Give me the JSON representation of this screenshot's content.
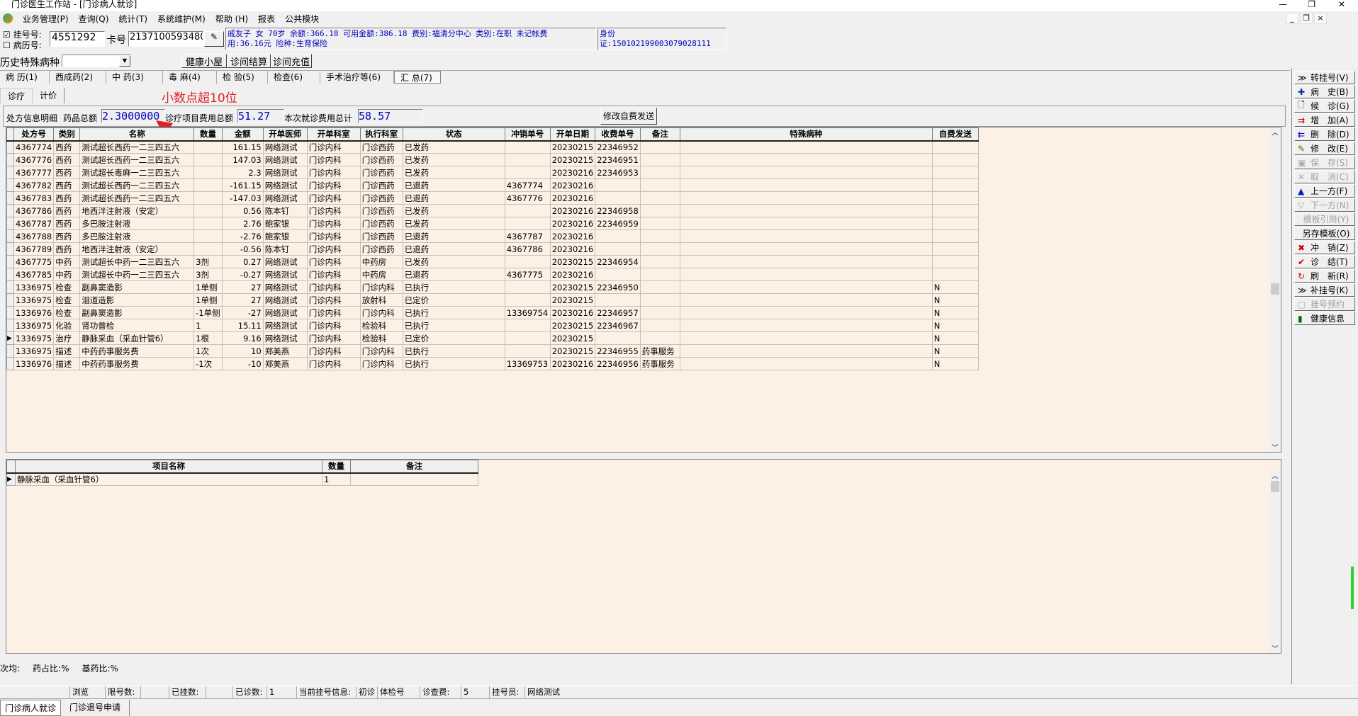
{
  "window": {
    "title": "门诊医生工作站 - [门诊病人就诊]"
  },
  "menu": [
    "业务管理(P)",
    "查询(Q)",
    "统计(T)",
    "系统维护(M)",
    "帮助 (H)",
    "报表",
    "公共模块"
  ],
  "patient": {
    "reg_checkbox_label": "挂号号:",
    "reg_checked": true,
    "record_checkbox_label": "病历号:",
    "record_checked": false,
    "reg_no": "4551292",
    "card_label": "卡号",
    "card_no": "2137100593480",
    "info_line1": "戚友子  女  70岁  余额:366.18  可用金额:386.18  费别:福清分中心  类别:在职  未记帐费",
    "info_line2": "用:36.16元  险种:生育保险",
    "id_line1": "身份",
    "id_line2": "证:150102199003079028111"
  },
  "history": {
    "label": "历史特殊病种",
    "value": "",
    "buttons": [
      "健康小屋",
      "诊间结算",
      "诊间充值"
    ]
  },
  "tabs": [
    "病 历(1)",
    "西成药(2)",
    "中 药(3)",
    "毒 麻(4)",
    "检 验(5)",
    "检查(6)",
    "手术治疗等(6)",
    "汇 总(7)"
  ],
  "active_tab": 7,
  "subtabs": [
    "诊疗",
    "计价"
  ],
  "annotation": {
    "text": "小数点超10位",
    "color": "#e02020"
  },
  "summary": {
    "label": "处方信息明细",
    "drug_label": "药品总额",
    "drug_total": "2.3000000",
    "item_label": "诊疗项目费用总额",
    "item_total": "51.27",
    "visit_label": "本次就诊费用总计",
    "visit_total": "58.57",
    "modify_button": "修改自费发送"
  },
  "main_table": {
    "columns": [
      "处方号",
      "类别",
      "名称",
      "数量",
      "金额",
      "开单医师",
      "开单科室",
      "执行科室",
      "状态",
      "冲销单号",
      "开单日期",
      "收费单号",
      "备注",
      "特殊病种",
      "自费发送"
    ],
    "current_row": 15,
    "rows": [
      [
        "4367774",
        "西药",
        "测试超长西药一二三四五六",
        "",
        "161.15",
        "网络测试",
        "门诊内科",
        "门诊西药",
        "已发药",
        "",
        "20230215",
        "22346952",
        "",
        "",
        ""
      ],
      [
        "4367776",
        "西药",
        "测试超长西药一二三四五六",
        "",
        "147.03",
        "网络测试",
        "门诊内科",
        "门诊西药",
        "已发药",
        "",
        "20230215",
        "22346951",
        "",
        "",
        ""
      ],
      [
        "4367777",
        "西药",
        "测试超长毒麻一二三四五六",
        "",
        "2.3",
        "网络测试",
        "门诊内科",
        "门诊西药",
        "已发药",
        "",
        "20230216",
        "22346953",
        "",
        "",
        ""
      ],
      [
        "4367782",
        "西药",
        "测试超长西药一二三四五六",
        "",
        "-161.15",
        "网络测试",
        "门诊内科",
        "门诊西药",
        "已退药",
        "4367774",
        "20230216",
        "",
        "",
        "",
        ""
      ],
      [
        "4367783",
        "西药",
        "测试超长西药一二三四五六",
        "",
        "-147.03",
        "网络测试",
        "门诊内科",
        "门诊西药",
        "已退药",
        "4367776",
        "20230216",
        "",
        "",
        "",
        ""
      ],
      [
        "4367786",
        "西药",
        "地西泮注射液（安定）",
        "",
        "0.56",
        "陈本钉",
        "门诊内科",
        "门诊西药",
        "已发药",
        "",
        "20230216",
        "22346958",
        "",
        "",
        ""
      ],
      [
        "4367787",
        "西药",
        "多巴胺注射液",
        "",
        "2.76",
        "鲍家银",
        "门诊内科",
        "门诊西药",
        "已发药",
        "",
        "20230216",
        "22346959",
        "",
        "",
        ""
      ],
      [
        "4367788",
        "西药",
        "多巴胺注射液",
        "",
        "-2.76",
        "鲍家银",
        "门诊内科",
        "门诊西药",
        "已退药",
        "4367787",
        "20230216",
        "",
        "",
        "",
        ""
      ],
      [
        "4367789",
        "西药",
        "地西泮注射液（安定）",
        "",
        "-0.56",
        "陈本钉",
        "门诊内科",
        "门诊西药",
        "已退药",
        "4367786",
        "20230216",
        "",
        "",
        "",
        ""
      ],
      [
        "4367775",
        "中药",
        "测试超长中药一二三四五六",
        "3剂",
        "0.27",
        "网络测试",
        "门诊内科",
        "中药房",
        "已发药",
        "",
        "20230215",
        "22346954",
        "",
        "",
        ""
      ],
      [
        "4367785",
        "中药",
        "测试超长中药一二三四五六",
        "3剂",
        "-0.27",
        "网络测试",
        "门诊内科",
        "中药房",
        "已退药",
        "4367775",
        "20230216",
        "",
        "",
        "",
        ""
      ],
      [
        "1336975",
        "检查",
        "副鼻窦造影",
        "1单侧",
        "27",
        "网络测试",
        "门诊内科",
        "门诊内科",
        "已执行",
        "",
        "20230215",
        "22346950",
        "",
        "",
        "N"
      ],
      [
        "1336975",
        "检查",
        "泪道造影",
        "1单侧",
        "27",
        "网络测试",
        "门诊内科",
        "放射科",
        "已定价",
        "",
        "20230215",
        "",
        "",
        "",
        "N"
      ],
      [
        "1336976",
        "检查",
        "副鼻窦造影",
        "-1单侧",
        "-27",
        "网络测试",
        "门诊内科",
        "门诊内科",
        "已执行",
        "13369754",
        "20230216",
        "22346957",
        "",
        "",
        "N"
      ],
      [
        "1336975",
        "化验",
        "肾功普检",
        "1",
        "15.11",
        "网络测试",
        "门诊内科",
        "检验科",
        "已执行",
        "",
        "20230215",
        "22346967",
        "",
        "",
        "N"
      ],
      [
        "1336975",
        "治疗",
        "静脉采血（采血针管6）",
        "1根",
        "9.16",
        "网络测试",
        "门诊内科",
        "检验科",
        "已定价",
        "",
        "20230215",
        "",
        "",
        "",
        "N"
      ],
      [
        "1336975",
        "描述",
        "中药药事服务费",
        "1次",
        "10",
        "郑美燕",
        "门诊内科",
        "门诊内科",
        "已执行",
        "",
        "20230215",
        "22346955",
        "药事服务",
        "",
        "N"
      ],
      [
        "1336976",
        "描述",
        "中药药事服务费",
        "-1次",
        "-10",
        "郑美燕",
        "门诊内科",
        "门诊内科",
        "已执行",
        "13369753",
        "20230216",
        "22346956",
        "药事服务",
        "",
        "N"
      ]
    ]
  },
  "detail_table": {
    "columns": [
      "项目名称",
      "数量",
      "备注"
    ],
    "rows": [
      [
        "静脉采血（采血针管6）",
        "1",
        ""
      ]
    ]
  },
  "right_buttons": [
    {
      "label": "转挂号(V)",
      "icon": "double-chevron-icon",
      "enabled": true
    },
    {
      "label": "病　史(B)",
      "icon": "plus-icon",
      "enabled": true
    },
    {
      "label": "候　诊(G)",
      "icon": "document-icon",
      "enabled": true
    },
    {
      "label": "增　加(A)",
      "icon": "add-row-icon",
      "enabled": true
    },
    {
      "label": "删　除(D)",
      "icon": "delete-row-icon",
      "enabled": true
    },
    {
      "label": "修　改(E)",
      "icon": "edit-icon",
      "enabled": true
    },
    {
      "label": "保　存(S)",
      "icon": "save-icon",
      "enabled": false
    },
    {
      "label": "取　消(C)",
      "icon": "cancel-icon",
      "enabled": false
    },
    {
      "label": "上一方(F)",
      "icon": "up-arrow-icon",
      "enabled": true
    },
    {
      "label": "下一方(N)",
      "icon": "down-arrow-icon",
      "enabled": false
    },
    {
      "label": "模板引用(Y)",
      "icon": "",
      "enabled": false
    },
    {
      "label": "另存模板(O)",
      "icon": "",
      "enabled": true
    },
    {
      "label": "冲　销(Z)",
      "icon": "x-icon",
      "enabled": true
    },
    {
      "label": "诊　结(T)",
      "icon": "check-icon",
      "enabled": true
    },
    {
      "label": "刷　新(R)",
      "icon": "refresh-icon",
      "enabled": true
    },
    {
      "label": "补挂号(K)",
      "icon": "double-chevron-icon",
      "enabled": true
    },
    {
      "label": "挂号预约",
      "icon": "calendar-icon",
      "enabled": false
    },
    {
      "label": "健康信息",
      "icon": "door-icon",
      "enabled": true
    }
  ],
  "stats": {
    "avg": "次均:",
    "drug_ratio": "药占比:%",
    "base_drug_ratio": "基药比:%"
  },
  "statusbar": [
    "浏览",
    "限号数:",
    "",
    "已挂数:",
    "",
    "已诊数:",
    "1",
    "当前挂号信息:",
    "初诊",
    "体检号",
    "诊查费:",
    "5",
    "挂号员:",
    "网络测试"
  ],
  "bottom_tabs": [
    "门诊病人就诊",
    "门诊退号申请"
  ]
}
